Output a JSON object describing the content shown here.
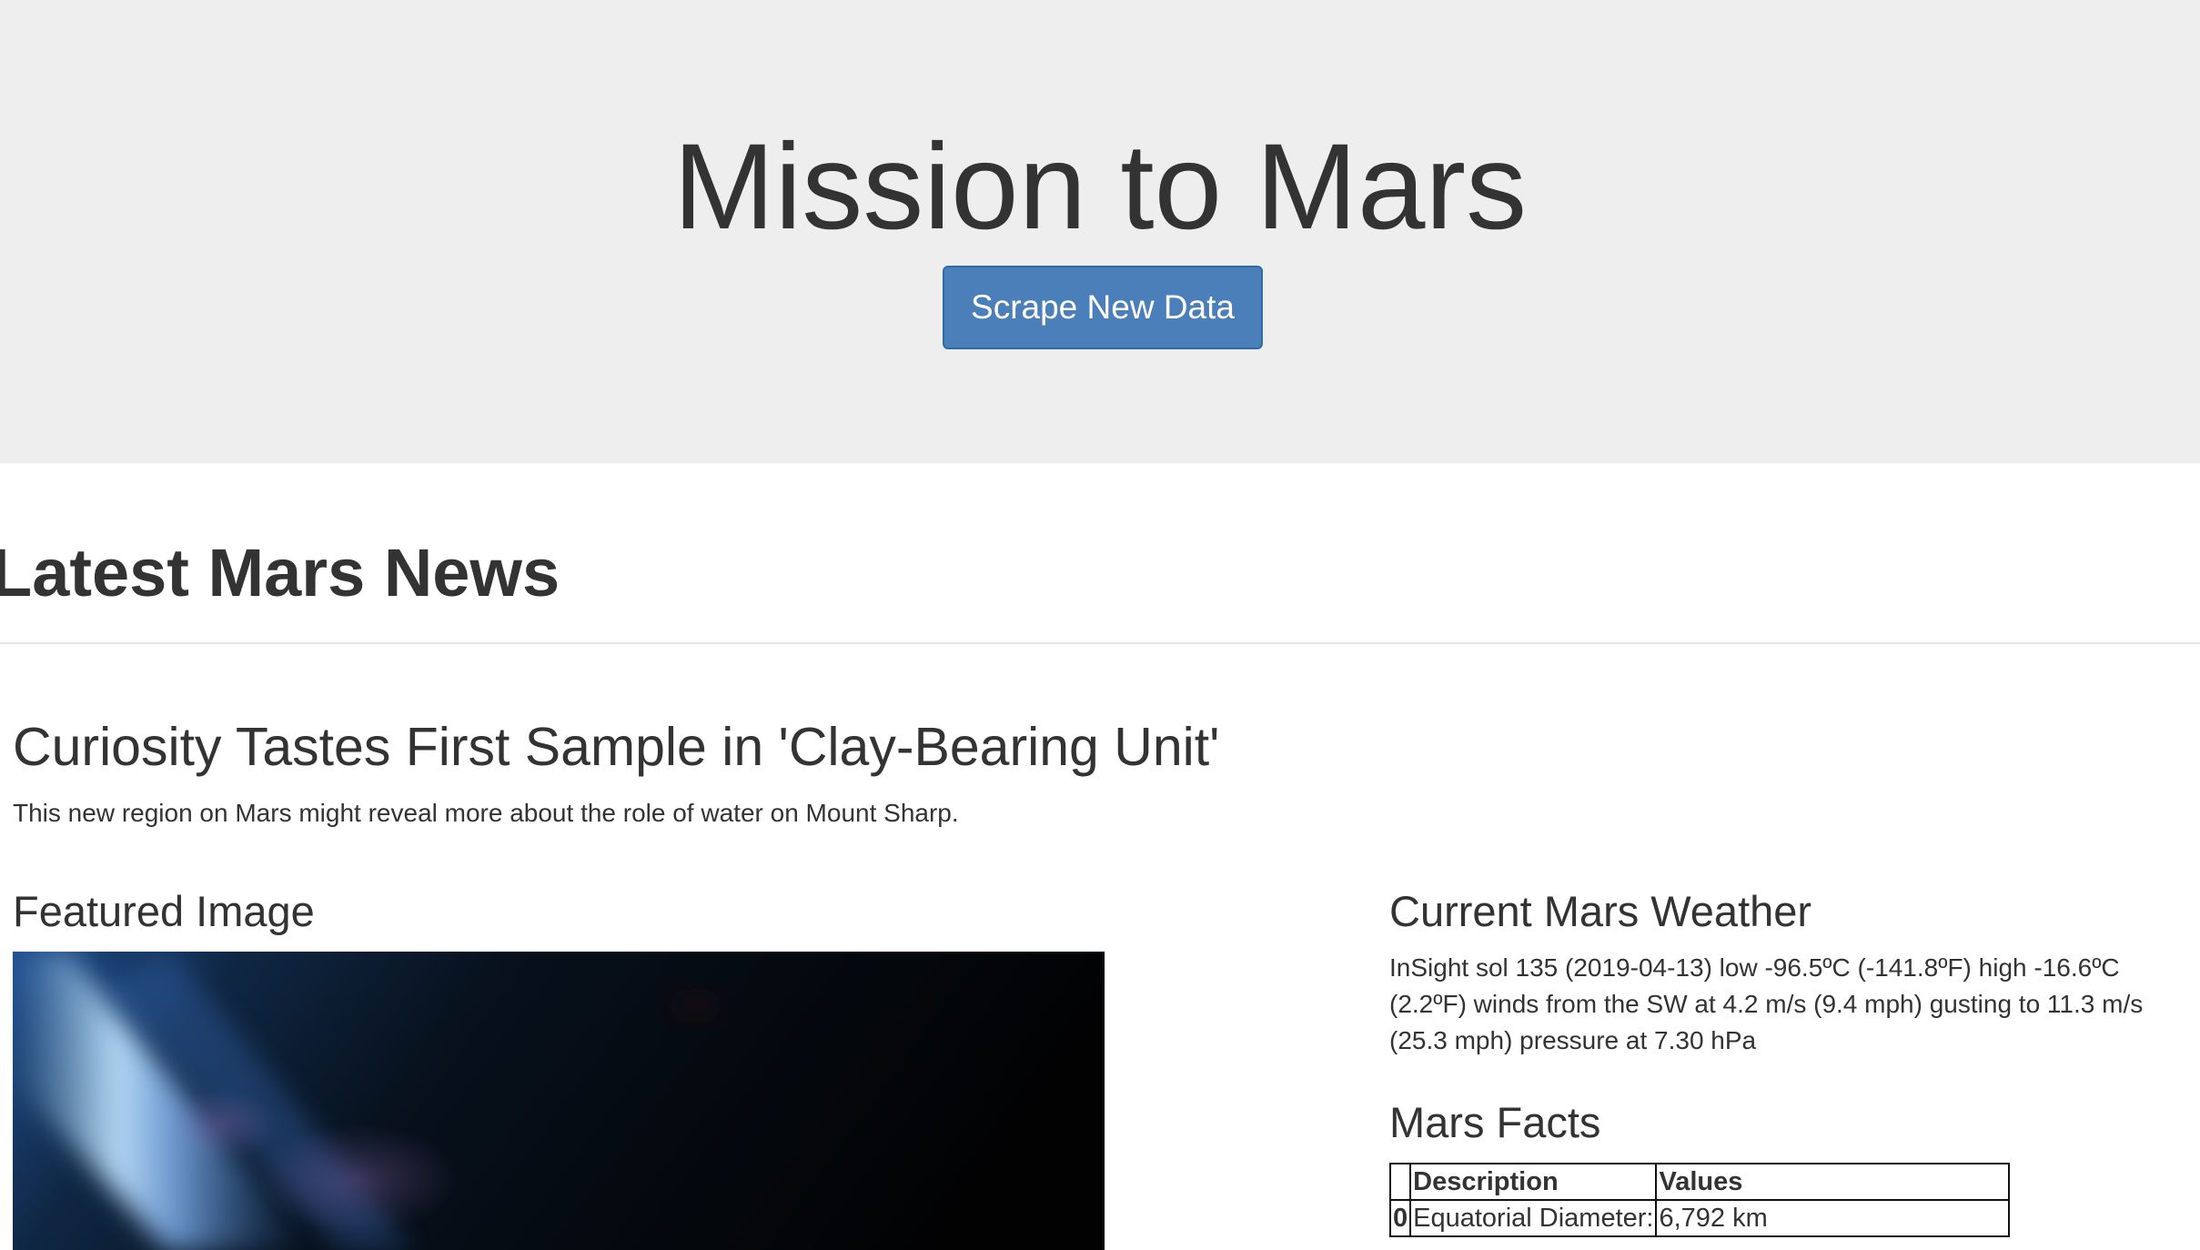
{
  "header": {
    "title": "Mission to Mars",
    "scrape_button_label": "Scrape New Data"
  },
  "news": {
    "section_heading": "Latest Mars News",
    "title": "Curiosity Tastes First Sample in 'Clay-Bearing Unit'",
    "teaser": "This new region on Mars might reveal more about the role of water on Mount Sharp."
  },
  "featured_image": {
    "heading": "Featured Image"
  },
  "weather": {
    "heading": "Current Mars Weather",
    "text": "InSight sol 135 (2019-04-13) low -96.5ºC (-141.8ºF) high -16.6ºC (2.2ºF) winds from the SW at 4.2 m/s (9.4 mph) gusting to 11.3 m/s (25.3 mph) pressure at 7.30 hPa"
  },
  "facts": {
    "heading": "Mars Facts",
    "columns": [
      "",
      "Description",
      "Values"
    ],
    "rows": [
      {
        "index": "0",
        "description": "Equatorial Diameter:",
        "value": "6,792 km"
      }
    ]
  }
}
